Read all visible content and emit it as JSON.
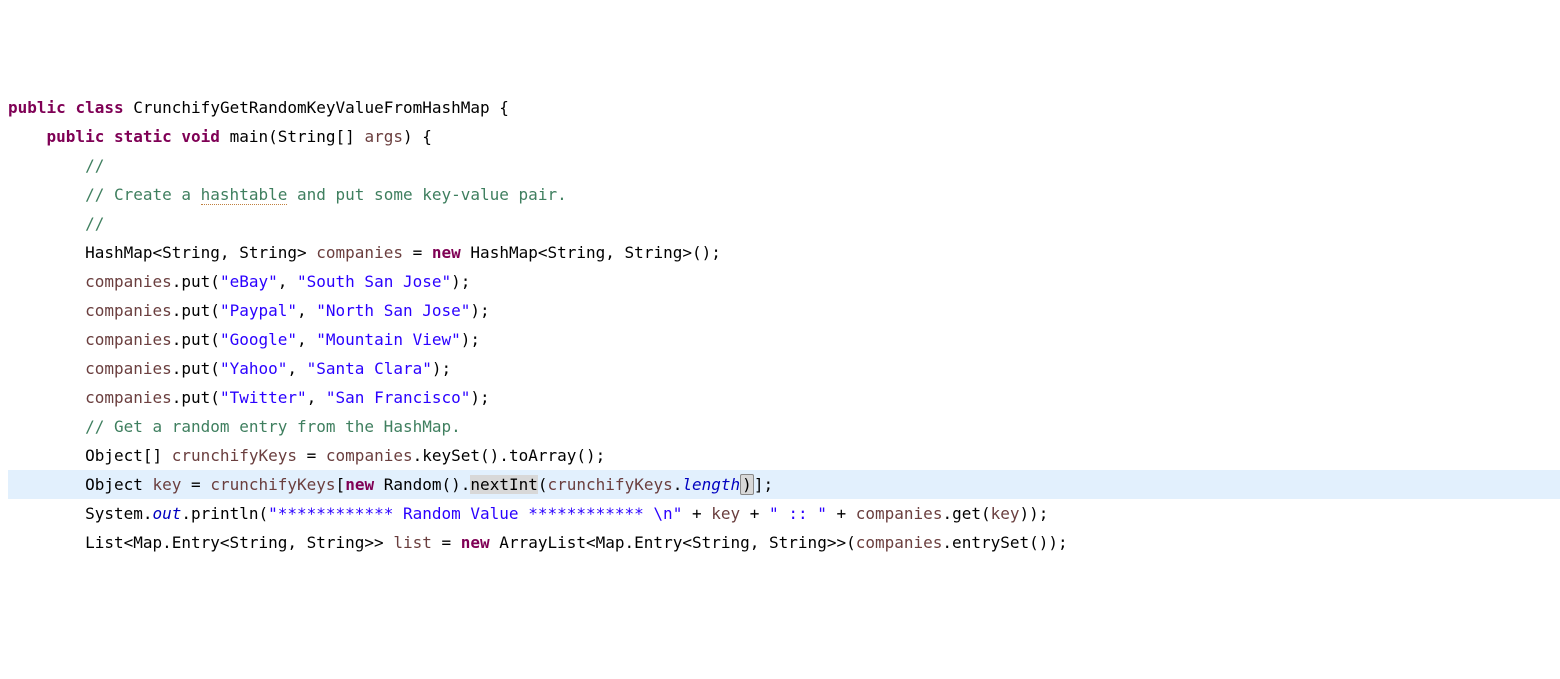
{
  "lines": {
    "l1": {
      "kw_public": "public",
      "kw_class": "class",
      "classname": "CrunchifyGetRandomKeyValueFromHashMap",
      "brace": " {"
    },
    "l2": {
      "kw_public": "public",
      "kw_static": "static",
      "kw_void": "void",
      "method": "main",
      "params_open": "(",
      "ptype": "String[]",
      "pname": "args",
      "params_close": ") {"
    },
    "l3": {
      "cmt": "//"
    },
    "l4": {
      "cmt_pre": "// Create a ",
      "cmt_warn": "hashtable",
      "cmt_post": " and put some key-value pair."
    },
    "l5": {
      "cmt": "//"
    },
    "l6": {
      "t1": "HashMap<String, String>",
      "var": "companies",
      "eq": " = ",
      "kw_new": "new",
      "t2": "HashMap<String, String>();"
    },
    "l7": {
      "obj": "companies",
      "dot": ".put(",
      "s1": "\"eBay\"",
      "comma": ", ",
      "s2": "\"South San Jose\"",
      "end": ");"
    },
    "l8": {
      "obj": "companies",
      "dot": ".put(",
      "s1": "\"Paypal\"",
      "comma": ", ",
      "s2": "\"North San Jose\"",
      "end": ");"
    },
    "l9": {
      "obj": "companies",
      "dot": ".put(",
      "s1": "\"Google\"",
      "comma": ", ",
      "s2": "\"Mountain View\"",
      "end": ");"
    },
    "l10": {
      "obj": "companies",
      "dot": ".put(",
      "s1": "\"Yahoo\"",
      "comma": ", ",
      "s2": "\"Santa Clara\"",
      "end": ");"
    },
    "l11": {
      "obj": "companies",
      "dot": ".put(",
      "s1": "\"Twitter\"",
      "comma": ", ",
      "s2": "\"San Francisco\"",
      "end": ");"
    },
    "l12": {
      "blank": ""
    },
    "l13": {
      "cmt": "// Get a random entry from the HashMap."
    },
    "l14": {
      "t1": "Object[]",
      "var": "crunchifyKeys",
      "eq": " = ",
      "obj": "companies",
      "rest": ".keySet().toArray();"
    },
    "l15": {
      "t1": "Object",
      "var": "key",
      "eq": " = ",
      "arr": "crunchifyKeys",
      "br_open": "[",
      "kw_new": "new",
      "rand": " Random().",
      "nextint": "nextInt",
      "paren_open": "(",
      "ck": "crunchifyKeys",
      "dot": ".",
      "len": "length",
      "paren_close": ")",
      "br_close": "];"
    },
    "l16": {
      "sys": "System.",
      "out": "out",
      "println": ".println(",
      "s1": "\"************ Random Value ************ \\n\"",
      "plus1": " + ",
      "key": "key",
      "plus2": " + ",
      "s2": "\" :: \"",
      "plus3": " + ",
      "comp": "companies",
      "get": ".get(",
      "key2": "key",
      "end": "));"
    },
    "l17": {
      "blank": ""
    },
    "l18": {
      "t1": "List<Map.Entry<String, String>>",
      "var": "list",
      "eq": " = ",
      "kw_new": "new",
      "t2": " ArrayList<Map.Entry<String, String>>(",
      "comp": "companies",
      "rest": ".entrySet());"
    }
  }
}
